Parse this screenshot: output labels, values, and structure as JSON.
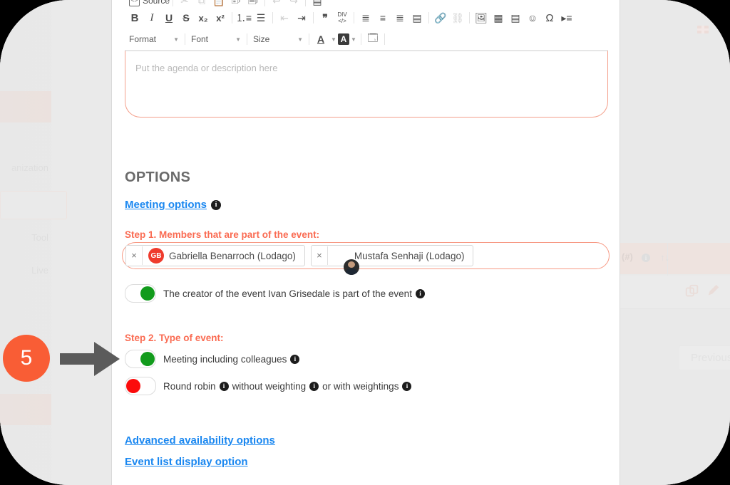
{
  "annotation": {
    "step_number": "5",
    "arrow_icon": "right-arrow-icon",
    "badge_color": "#f95d35"
  },
  "editor": {
    "source_label": "Source",
    "placeholder": "Put the agenda or description here",
    "border_color": "#f79a85",
    "row1_icons": [
      "source-icon",
      "cut-icon",
      "copy-icon",
      "paste-icon",
      "paste-text-icon",
      "paste-word-icon",
      "undo-icon",
      "redo-icon",
      "templates-icon"
    ],
    "row2_icons": [
      "bold-icon",
      "italic-icon",
      "underline-icon",
      "strikethrough-icon",
      "subscript-icon",
      "superscript-icon",
      "numbered-list-icon",
      "bulleted-list-icon",
      "outdent-icon",
      "indent-icon",
      "blockquote-icon",
      "div-container-icon",
      "align-left-icon",
      "align-center-icon",
      "align-right-icon",
      "justify-icon",
      "link-icon",
      "unlink-icon",
      "image-icon",
      "table-icon",
      "horizontal-rule-icon",
      "smiley-icon",
      "special-character-icon",
      "page-break-icon"
    ],
    "row2_glyphs": [
      "B",
      "I",
      "U",
      "S",
      "x₂",
      "x²"
    ],
    "selects": [
      {
        "name": "format-select",
        "value": "Format"
      },
      {
        "name": "font-select",
        "value": "Font"
      },
      {
        "name": "size-select",
        "value": "Size"
      }
    ],
    "color_tools": [
      "text-color-icon",
      "background-color-icon",
      "show-blocks-icon"
    ]
  },
  "options": {
    "heading": "OPTIONS",
    "meeting_options_link": "Meeting options",
    "step1_label": "Step 1. Members that are part of the event:",
    "members": [
      {
        "remove": "×",
        "initials": "GB",
        "avatar_type": "initials",
        "name": "Gabriella Benarroch (Lodago)"
      },
      {
        "remove": "×",
        "initials": "",
        "avatar_type": "photo",
        "name": "Mustafa Senhaji (Lodago)"
      }
    ],
    "creator_toggle": {
      "state": "on",
      "label": "The creator of the event Ivan Grisedale is part of the event"
    },
    "step2_label": "Step 2. Type of event:",
    "type_toggles": [
      {
        "state": "on",
        "label": "Meeting including colleagues"
      },
      {
        "state": "off",
        "label_part1": "Round robin",
        "label_part2": "without weighting",
        "label_part3": "or with weightings"
      }
    ],
    "bottom_links": [
      "Advanced availability options",
      "Event list display option"
    ],
    "step_color": "#fa6b52",
    "link_color": "#1a87f0"
  },
  "background_left": {
    "items": [
      "anization",
      "Tool",
      "Live"
    ]
  },
  "background_right": {
    "table_header": "(#)",
    "sort_icon": "sort-icon",
    "row_icons": [
      "duplicate-icon",
      "edit-pencil-icon"
    ],
    "previous_button": "Previous",
    "flag_icon": "uk-flag-icon"
  }
}
